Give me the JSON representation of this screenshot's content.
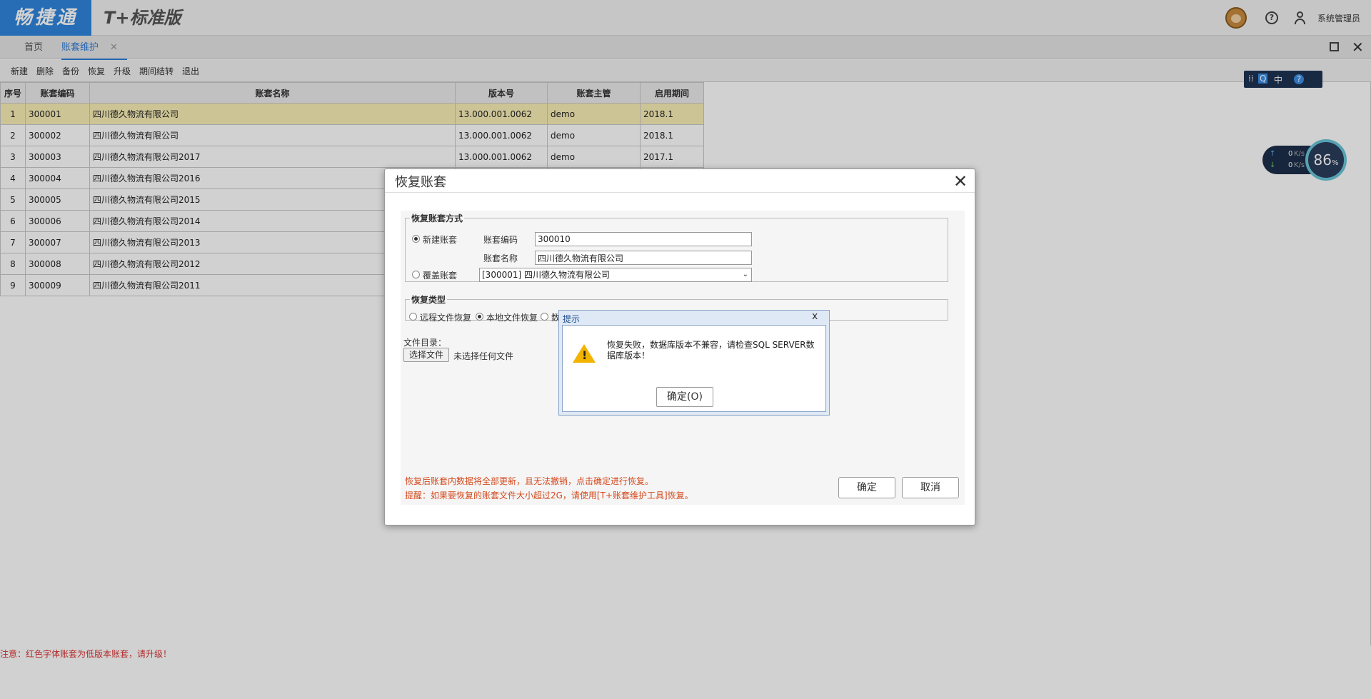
{
  "header": {
    "logo_text": "畅捷通",
    "product_text": "T+标准版",
    "username": "系统管理员"
  },
  "tabs": [
    {
      "label": "首页"
    },
    {
      "label": "账套维护",
      "close": "✕"
    }
  ],
  "toolbar": [
    "新建",
    "删除",
    "备份",
    "恢复",
    "升级",
    "期间结转",
    "退出"
  ],
  "grid": {
    "columns": [
      "序号",
      "账套编码",
      "账套名称",
      "版本号",
      "账套主管",
      "启用期间"
    ],
    "rows": [
      [
        "1",
        "300001",
        "四川德久物流有限公司",
        "13.000.001.0062",
        "demo",
        "2018.1"
      ],
      [
        "2",
        "300002",
        "四川德久物流有限公司",
        "13.000.001.0062",
        "demo",
        "2018.1"
      ],
      [
        "3",
        "300003",
        "四川德久物流有限公司2017",
        "13.000.001.0062",
        "demo",
        "2017.1"
      ],
      [
        "4",
        "300004",
        "四川德久物流有限公司2016",
        "",
        "",
        ""
      ],
      [
        "5",
        "300005",
        "四川德久物流有限公司2015",
        "",
        "",
        ""
      ],
      [
        "6",
        "300006",
        "四川德久物流有限公司2014",
        "",
        "",
        ""
      ],
      [
        "7",
        "300007",
        "四川德久物流有限公司2013",
        "",
        "",
        ""
      ],
      [
        "8",
        "300008",
        "四川德久物流有限公司2012",
        "",
        "",
        ""
      ],
      [
        "9",
        "300009",
        "四川德久物流有限公司2011",
        "",
        "",
        ""
      ]
    ]
  },
  "notice": "注意：红色字体账套为低版本账套，请升级！",
  "ime": {
    "lang": "中"
  },
  "net": {
    "up": "0",
    "down": "0",
    "unit": "K/s",
    "percent": "86",
    "percent_sign": "%"
  },
  "dialog": {
    "title": "恢复账套",
    "method_legend": "恢复账套方式",
    "new_label": "新建账套",
    "code_label": "账套编码",
    "code_value": "300010",
    "name_label": "账套名称",
    "name_value": "四川德久物流有限公司",
    "overwrite_label": "覆盖账套",
    "overwrite_value": "[300001] 四川德久物流有限公司",
    "type_legend": "恢复类型",
    "remote_label": "远程文件恢复",
    "local_label": "本地文件恢复",
    "other_label": "数",
    "dir_label": "文件目录：",
    "choose_file": "选择文件",
    "no_file": "未选择任何文件",
    "warn1": "恢复后账套内数据将全部更新，且无法撤销，点击确定进行恢复。",
    "warn2": "提醒：如果要恢复的账套文件大小超过2G，请使用[T+账套维护工具]恢复。",
    "ok": "确定",
    "cancel": "取消"
  },
  "alert": {
    "title": "提示",
    "close": "x",
    "message": "恢复失败，数据库版本不兼容，请检查SQL SERVER数据库版本！",
    "ok": "确定(O)"
  },
  "colors": {
    "brand": "#2f86df",
    "tab_active": "#2d7dd8",
    "warning_text": "#d44a1e",
    "notice_text": "#dd3333",
    "selected_row": "#fbf0b8"
  }
}
